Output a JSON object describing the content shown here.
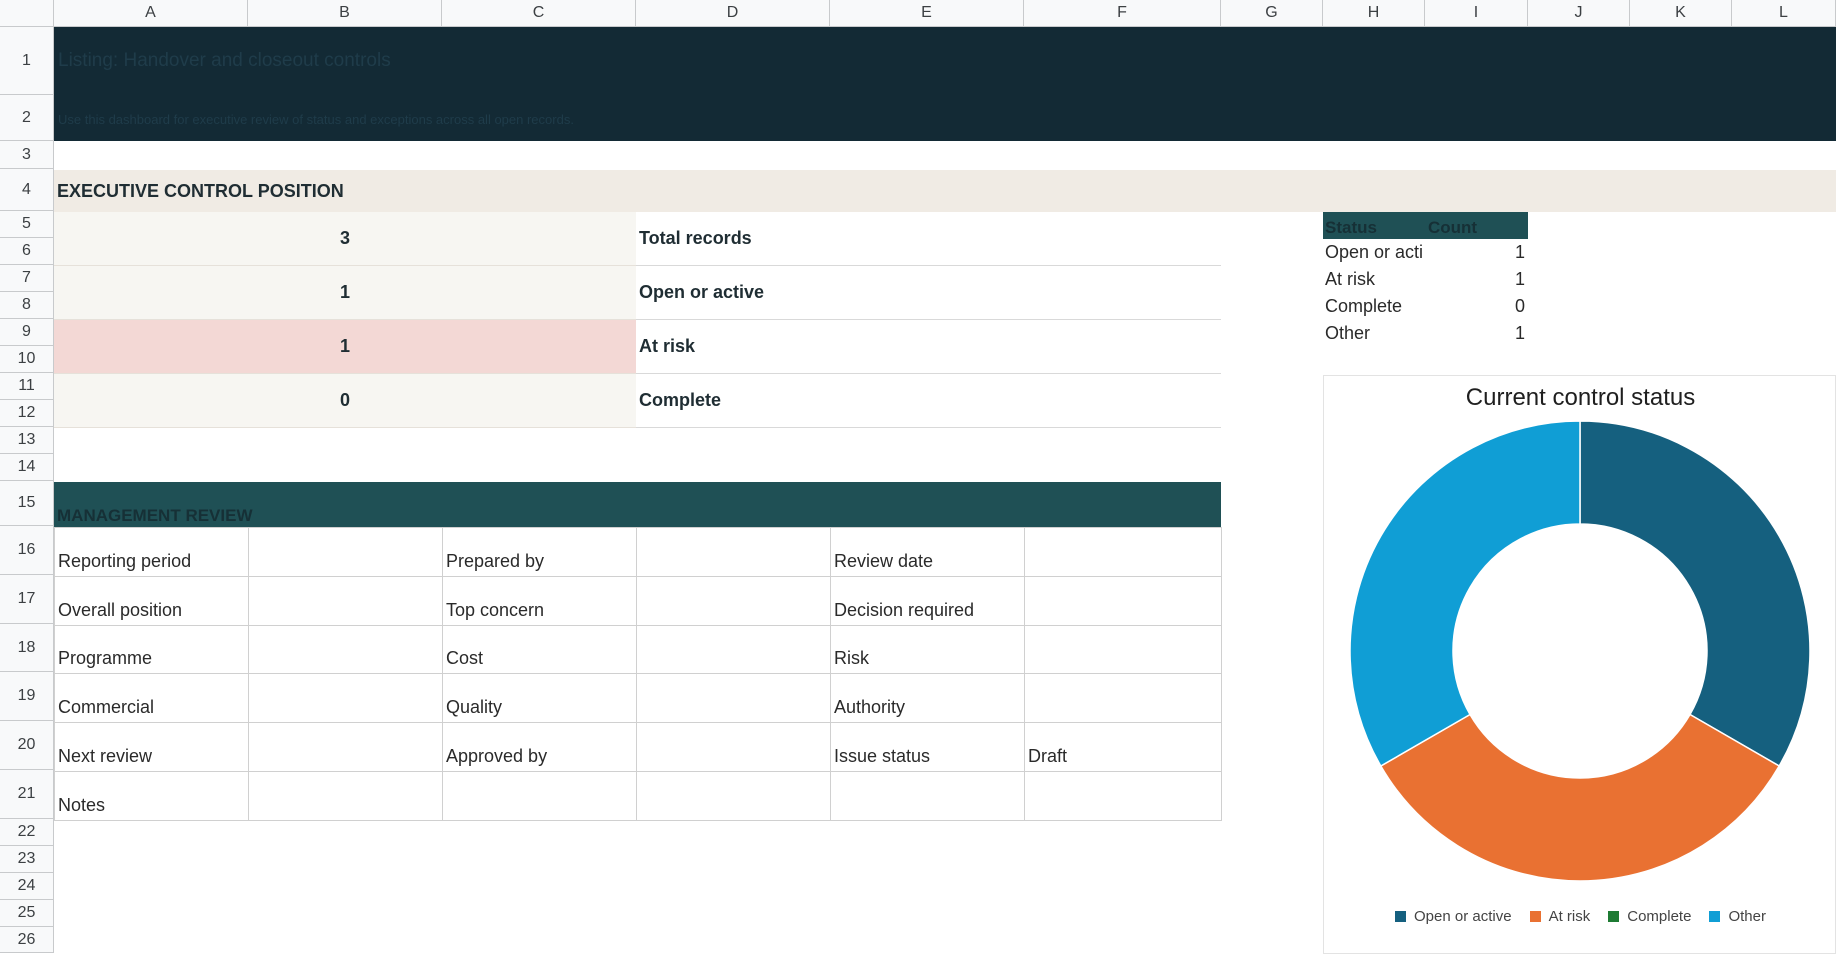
{
  "columns": [
    "A",
    "B",
    "C",
    "D",
    "E",
    "F",
    "G",
    "H",
    "I",
    "J",
    "K",
    "L"
  ],
  "rows": [
    "1",
    "2",
    "3",
    "4",
    "5",
    "6",
    "7",
    "8",
    "9",
    "10",
    "11",
    "12",
    "13",
    "14",
    "15",
    "16",
    "17",
    "18",
    "19",
    "20",
    "21",
    "22",
    "23",
    "24",
    "25",
    "26"
  ],
  "banner": {
    "title": "Listing: Handover and closeout controls",
    "subtitle": "Use this dashboard for executive review of status and exceptions across all open records."
  },
  "section_exec": "EXECUTIVE CONTROL POSITION",
  "kpis": [
    {
      "value": "3",
      "label": "Total records"
    },
    {
      "value": "1",
      "label": "Open or active"
    },
    {
      "value": "1",
      "label": "At risk"
    },
    {
      "value": "0",
      "label": "Complete"
    }
  ],
  "section_mgmt": "MANAGEMENT REVIEW",
  "mgmt_rows": [
    [
      "Reporting period",
      "",
      "Prepared by",
      "",
      "Review date",
      ""
    ],
    [
      "Overall position",
      "",
      "Top concern",
      "",
      "Decision required",
      ""
    ],
    [
      "Programme",
      "",
      "Cost",
      "",
      "Risk",
      ""
    ],
    [
      "Commercial",
      "",
      "Quality",
      "",
      "Authority",
      ""
    ],
    [
      "Next review",
      "",
      "Approved by",
      "",
      "Issue status",
      "Draft"
    ],
    [
      "Notes",
      "",
      "",
      "",
      "",
      ""
    ]
  ],
  "status_table": {
    "headers": [
      "Status",
      "Count"
    ],
    "rows": [
      {
        "status": "Open or acti",
        "count": "1"
      },
      {
        "status": "At risk",
        "count": "1"
      },
      {
        "status": "Complete",
        "count": "0"
      },
      {
        "status": "Other",
        "count": "1"
      }
    ]
  },
  "colors": {
    "banner": "#132a35",
    "exec_band": "#f0ebe4",
    "kpi_fill": "#f7f6f2",
    "kpi_risk_fill": "#f3d8d5",
    "mgmt_band": "#1f5055",
    "status_header": "#1f5055"
  },
  "chart_data": {
    "type": "pie",
    "title": "Current control status",
    "categories": [
      "Open or active",
      "At risk",
      "Complete",
      "Other"
    ],
    "values": [
      1,
      1,
      0,
      1
    ],
    "colors": [
      "#15607f",
      "#e97132",
      "#1e7b33",
      "#109ed5"
    ],
    "legend": "bottom"
  }
}
